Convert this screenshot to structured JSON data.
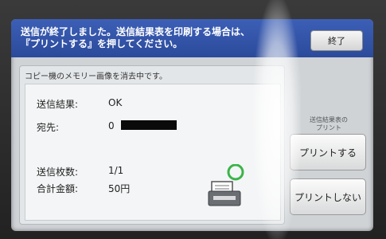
{
  "header": {
    "message": "送信が終了しました。送信結果表を印刷する場合は、\n『プリントする』を押してください。",
    "end_button": "終了"
  },
  "panel": {
    "title": "コピー機のメモリー画像を消去中です。",
    "rows": [
      {
        "label": "送信結果:",
        "value": "OK"
      },
      {
        "label": "宛先:",
        "value": "0"
      },
      {
        "label": "送信枚数:",
        "value": "1/1"
      },
      {
        "label": "合計金額:",
        "value": "50円"
      }
    ]
  },
  "side": {
    "caption": "送信結果表の\nプリント",
    "print_button": "プリントする",
    "no_print_button": "プリントしない"
  },
  "icons": {
    "printer": "printer-icon",
    "status_ring": "status-ring-icon"
  },
  "colors": {
    "header": "#2b4a9b",
    "ring": "#3bb44a"
  }
}
